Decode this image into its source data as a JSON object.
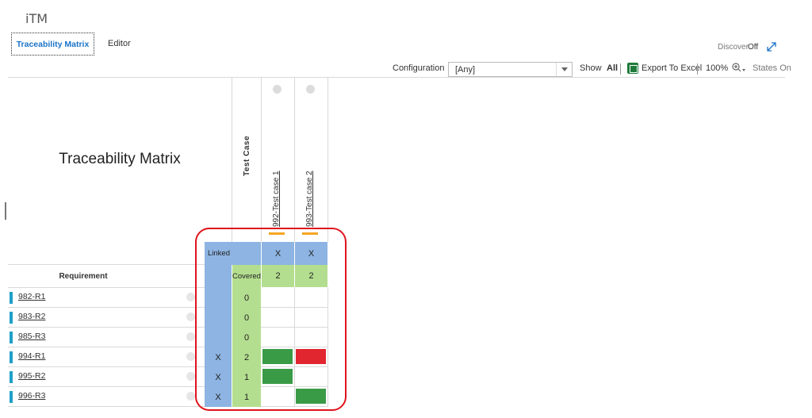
{
  "app": {
    "title": "iTM"
  },
  "tabs": [
    {
      "label": "Traceability Matrix",
      "active": true
    },
    {
      "label": "Editor",
      "active": false
    }
  ],
  "discover": {
    "label": "Discover",
    "value": "Off"
  },
  "toolbar": {
    "configuration_label": "Configuration",
    "configuration_value": "[Any]",
    "show_label": "Show",
    "show_value": "All",
    "export_label": "Export To Excel",
    "zoom": "100%",
    "states_label": "States On"
  },
  "matrix": {
    "title": "Traceability Matrix",
    "test_case_header": "Test Case",
    "requirement_header": "Requirement",
    "linked_label": "Linked",
    "covered_label": "Covered",
    "test_cases": [
      {
        "label": "992-Test case 1",
        "linked": "X",
        "covered": "2"
      },
      {
        "label": "993-Test case 2",
        "linked": "X",
        "covered": "2"
      }
    ],
    "requirements": [
      {
        "label": "982-R1",
        "linked": "",
        "covered": "0",
        "cells": [
          "",
          ""
        ]
      },
      {
        "label": "983-R2",
        "linked": "",
        "covered": "0",
        "cells": [
          "",
          ""
        ]
      },
      {
        "label": "985-R3",
        "linked": "",
        "covered": "0",
        "cells": [
          "",
          ""
        ]
      },
      {
        "label": "994-R1",
        "linked": "X",
        "covered": "2",
        "cells": [
          "pass",
          "fail"
        ]
      },
      {
        "label": "995-R2",
        "linked": "X",
        "covered": "1",
        "cells": [
          "pass",
          ""
        ]
      },
      {
        "label": "996-R3",
        "linked": "X",
        "covered": "1",
        "cells": [
          "",
          "pass"
        ]
      }
    ]
  },
  "colors": {
    "accent": "#1a73c8",
    "linked": "#8db4e2",
    "covered": "#b4de8f",
    "pass": "#3a9b47",
    "fail": "#e1262f",
    "annotation": "#e0141c"
  }
}
